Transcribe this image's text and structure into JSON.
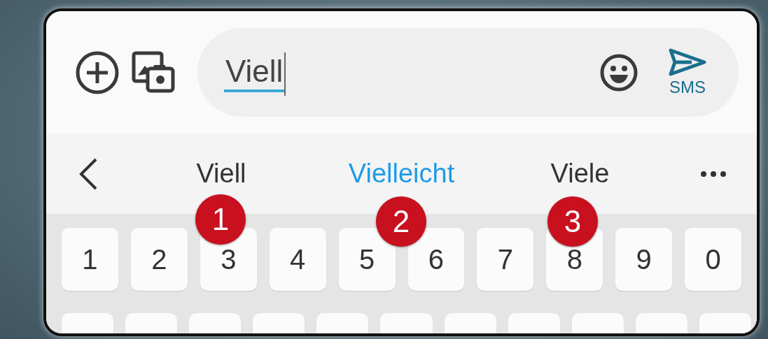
{
  "composer": {
    "value": "Viell",
    "send_label": "SMS"
  },
  "suggestions": [
    {
      "text": "Viell",
      "selected": false
    },
    {
      "text": "Vielleicht",
      "selected": true
    },
    {
      "text": "Viele",
      "selected": false
    }
  ],
  "number_row": [
    "1",
    "2",
    "3",
    "4",
    "5",
    "6",
    "7",
    "8",
    "9",
    "0"
  ],
  "annotations": [
    {
      "number": "1"
    },
    {
      "number": "2"
    },
    {
      "number": "3"
    }
  ]
}
